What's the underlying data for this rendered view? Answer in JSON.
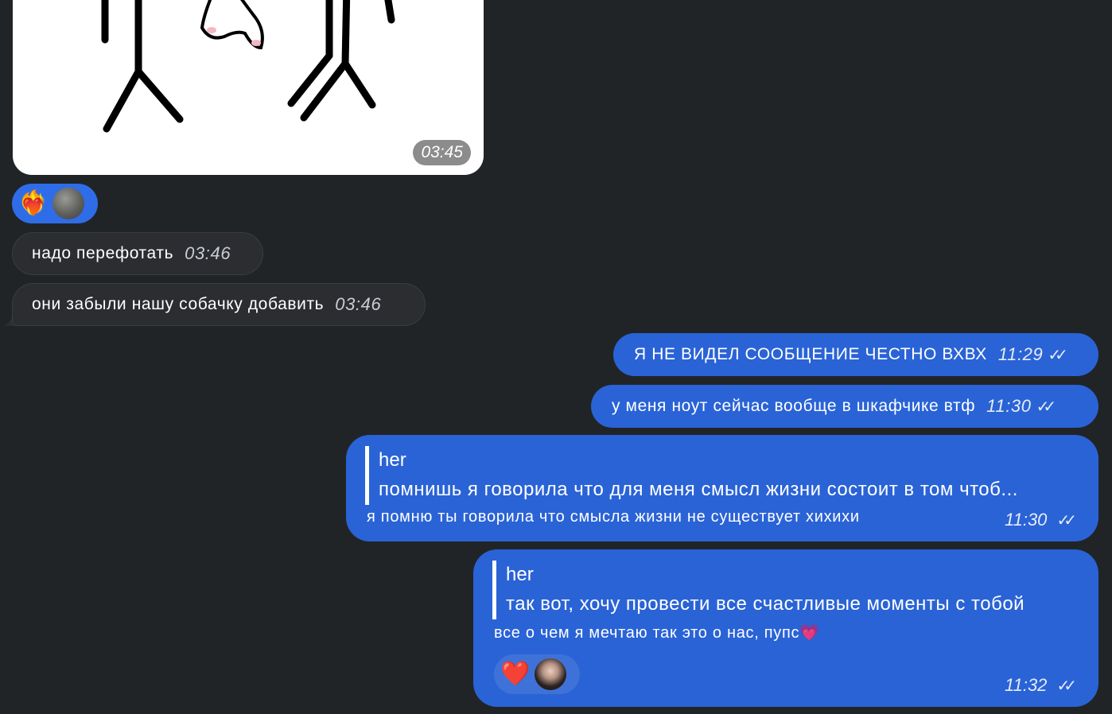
{
  "photo_message": {
    "time": "03:45"
  },
  "reaction_incoming": {
    "emoji": "❤️‍🔥"
  },
  "messages_in": [
    {
      "text": "надо перефотать",
      "time": "03:46"
    },
    {
      "text": "они забыли нашу собачку добавить",
      "time": "03:46"
    }
  ],
  "messages_out": [
    {
      "text": "Я НЕ ВИДЕЛ СООБЩЕНИЕ ЧЕСТНО ВХВХ",
      "time": "11:29"
    },
    {
      "text": "у меня ноут сейчас вообще в шкафчике втф",
      "time": "11:30"
    }
  ],
  "reply1": {
    "quote_author": "her",
    "quote_text": "помнишь я говорила что для меня смысл жизни состоит в том чтоб...",
    "text": "я помню ты говорила что смысла жизни не существует хихихи",
    "time": "11:30"
  },
  "reply2": {
    "quote_author": "her",
    "quote_text": "так вот, хочу провести все счастливые моменты с тобой",
    "text": "все о чем я мечтаю так это о нас, пупс💗",
    "time": "11:32",
    "reaction_emoji": "❤️"
  },
  "icons": {
    "read_receipt": "double-check-icon"
  },
  "colors": {
    "background": "#212427",
    "incoming_bubble": "#2b2d31",
    "outgoing_bubble": "#2a63d6",
    "reaction_blue": "#2f6de8"
  }
}
